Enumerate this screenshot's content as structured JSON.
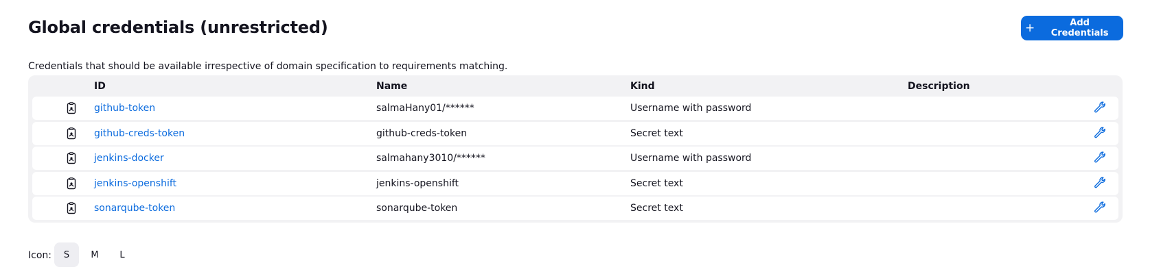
{
  "header": {
    "title": "Global credentials (unrestricted)",
    "add_button_icon": "plus-icon",
    "add_button_label": "Add Credentials"
  },
  "description": "Credentials that should be available irrespective of domain specification to requirements matching.",
  "table": {
    "columns": [
      "ID",
      "Name",
      "Kind",
      "Description"
    ],
    "rows": [
      {
        "icon": "credential-icon",
        "id": "github-token",
        "name": "salmaHany01/******",
        "kind": "Username with password",
        "description": "",
        "action_icon": "wrench-icon"
      },
      {
        "icon": "credential-icon",
        "id": "github-creds-token",
        "name": "github-creds-token",
        "kind": "Secret text",
        "description": "",
        "action_icon": "wrench-icon"
      },
      {
        "icon": "credential-icon",
        "id": "jenkins-docker",
        "name": "salmahany3010/******",
        "kind": "Username with password",
        "description": "",
        "action_icon": "wrench-icon"
      },
      {
        "icon": "credential-icon",
        "id": "jenkins-openshift",
        "name": "jenkins-openshift",
        "kind": "Secret text",
        "description": "",
        "action_icon": "wrench-icon"
      },
      {
        "icon": "credential-icon",
        "id": "sonarqube-token",
        "name": "sonarqube-token",
        "kind": "Secret text",
        "description": "",
        "action_icon": "wrench-icon"
      }
    ]
  },
  "icon_size": {
    "label": "Icon:",
    "options": [
      "S",
      "M",
      "L"
    ],
    "selected": "S"
  },
  "colors": {
    "accent": "#0b6bde",
    "table_bg": "#f2f2f4"
  }
}
